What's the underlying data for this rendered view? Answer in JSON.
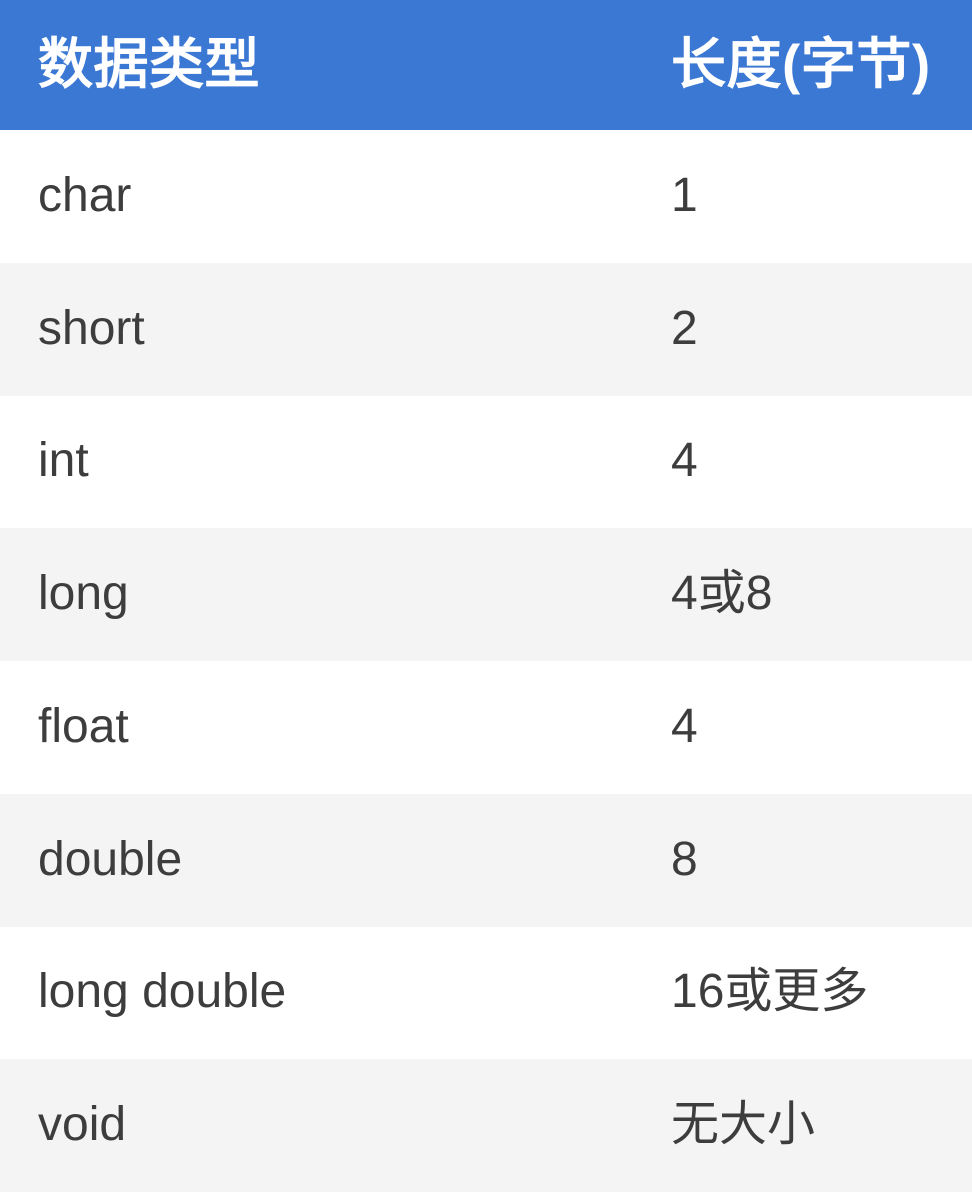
{
  "table": {
    "name": "c-data-type-size-table",
    "columns": [
      {
        "key": "type",
        "label": "数据类型"
      },
      {
        "key": "size",
        "label": "长度(字节)"
      }
    ],
    "rows": [
      {
        "type": "char",
        "size": "1"
      },
      {
        "type": "short",
        "size": "2"
      },
      {
        "type": "int",
        "size": "4"
      },
      {
        "type": "long",
        "size": "4或8"
      },
      {
        "type": "float",
        "size": "4"
      },
      {
        "type": "double",
        "size": "8"
      },
      {
        "type": "long double",
        "size": "16或更多"
      },
      {
        "type": "void",
        "size": "无大小"
      }
    ],
    "colors": {
      "header_background": "#3b78d4",
      "header_text": "#ffffff",
      "row_odd_background": "#ffffff",
      "row_even_background": "#f4f4f4",
      "body_text": "#3d3d3d"
    }
  }
}
